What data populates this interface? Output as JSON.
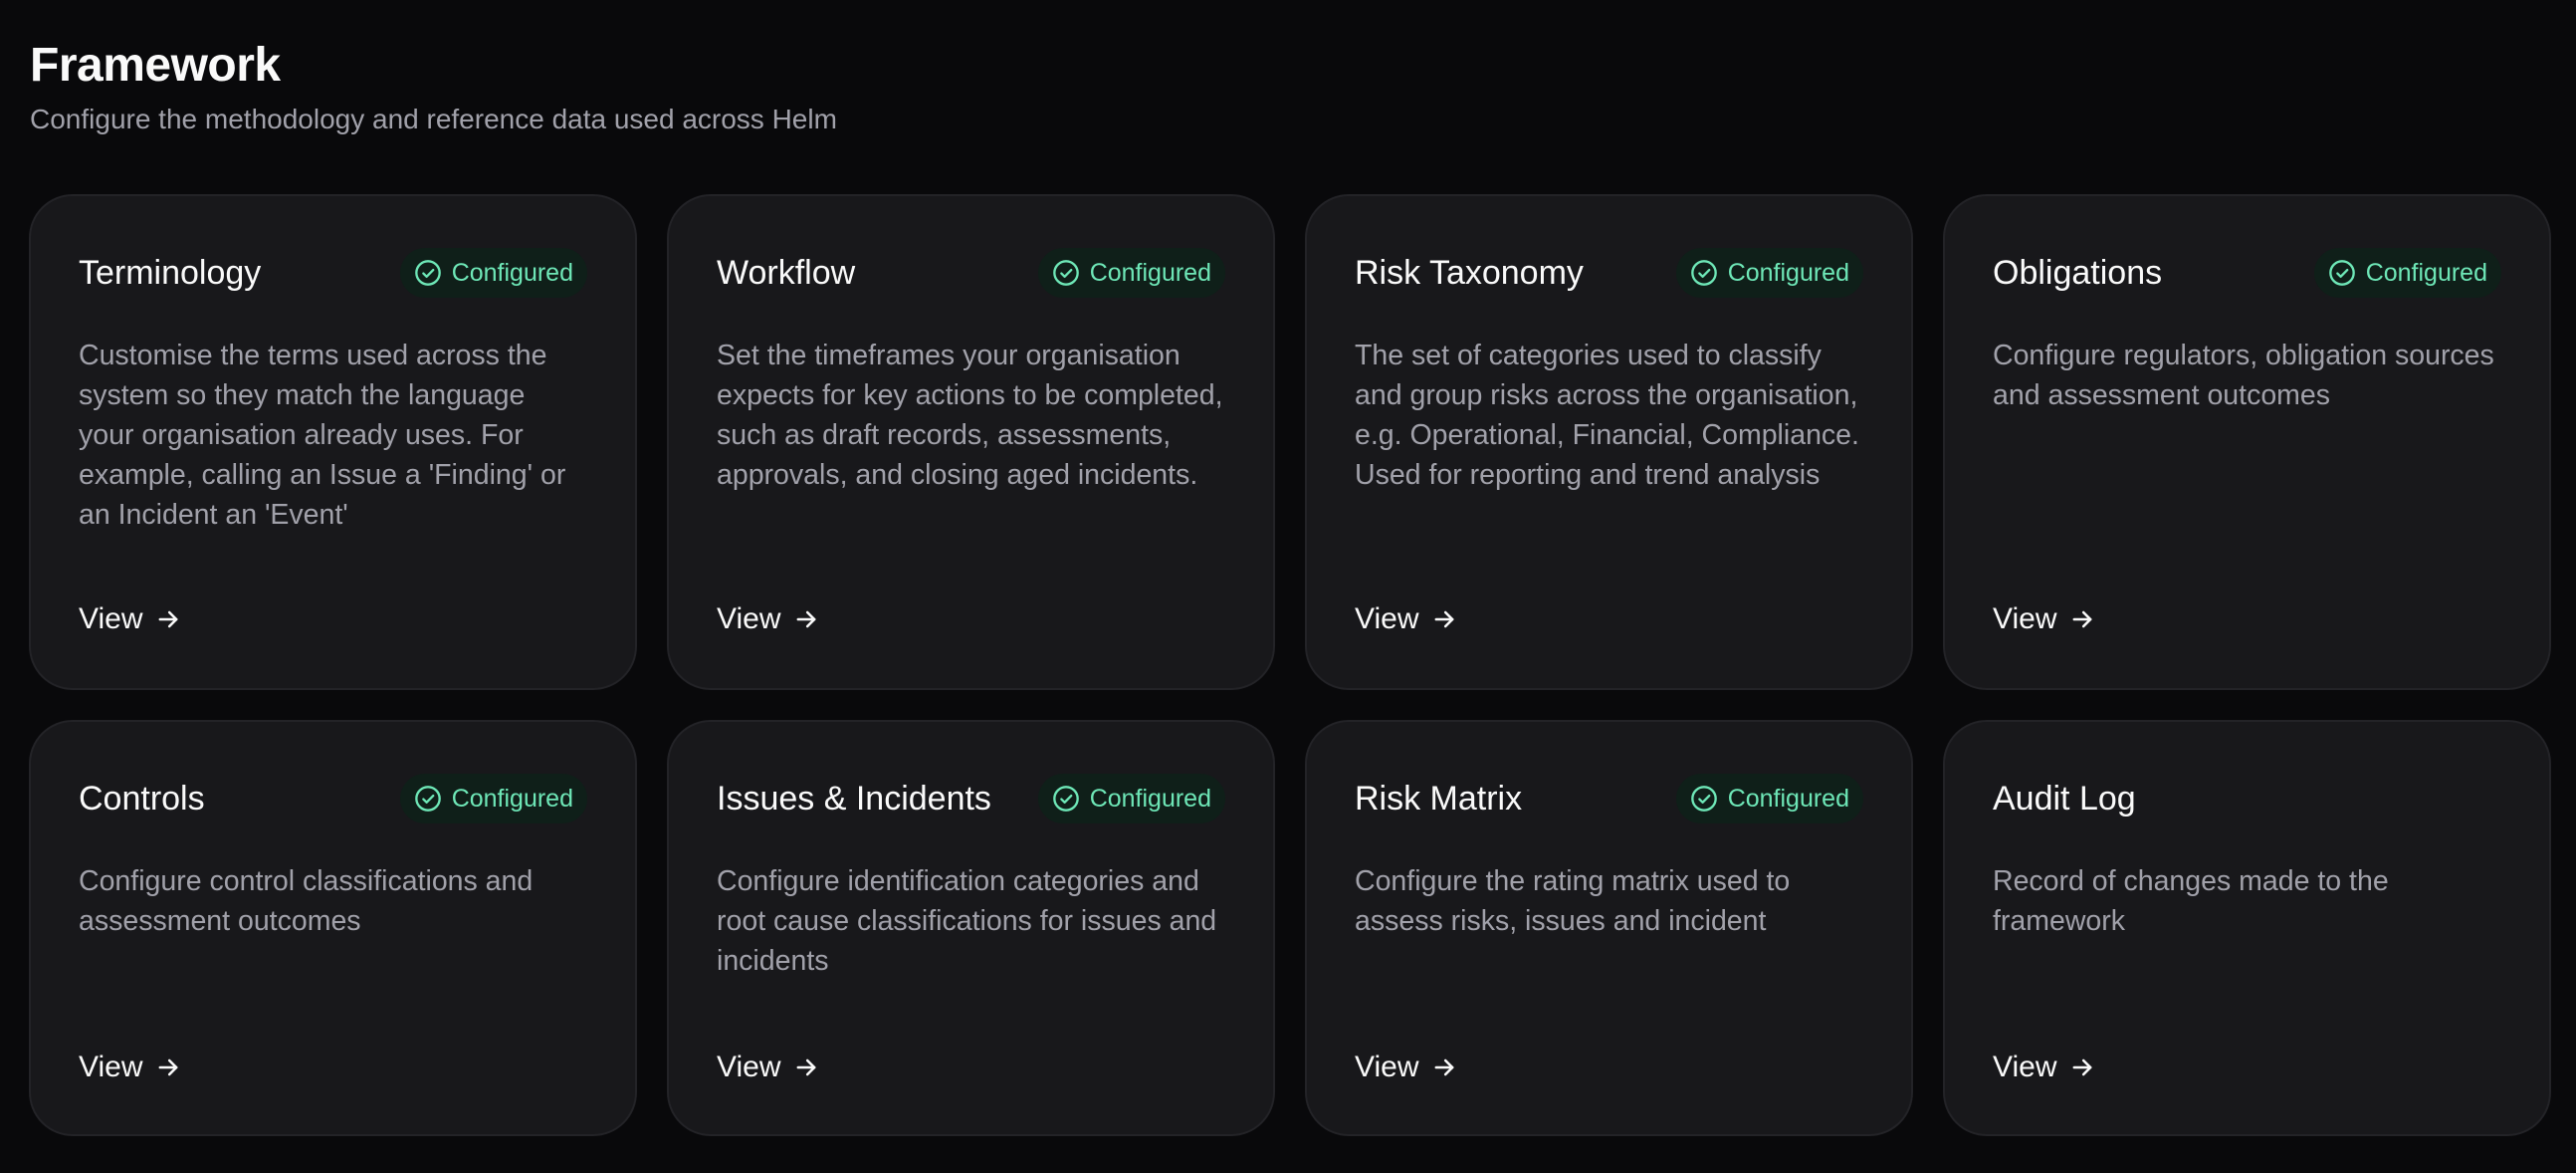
{
  "header": {
    "title": "Framework",
    "subtitle": "Configure the methodology and reference data used across Helm"
  },
  "colors": {
    "background": "#09090b",
    "card": "#18181b",
    "status_green": "#6ee7b7",
    "muted_text": "#a1a1aa"
  },
  "cards": [
    {
      "title": "Terminology",
      "status": "Configured",
      "description": "Customise the terms used across the system so they match the language your organisation already uses. For example, calling an Issue a 'Finding' or an Incident an 'Event'",
      "link": "View",
      "icon": "check-circle-icon"
    },
    {
      "title": "Workflow",
      "status": "Configured",
      "description": "Set the timeframes your organisation expects for key actions to be completed, such as draft records, assessments, approvals, and closing aged incidents.",
      "link": "View",
      "icon": "check-circle-icon"
    },
    {
      "title": "Risk Taxonomy",
      "status": "Configured",
      "description": "The set of categories used to classify and group risks across the organisation, e.g. Operational, Financial, Compliance. Used for reporting and trend analysis",
      "link": "View",
      "icon": "check-circle-icon"
    },
    {
      "title": "Obligations",
      "status": "Configured",
      "description": "Configure regulators, obligation sources and assessment outcomes",
      "link": "View",
      "icon": "check-circle-icon"
    },
    {
      "title": "Controls",
      "status": "Configured",
      "description": "Configure control classifications and assessment outcomes",
      "link": "View",
      "icon": "check-circle-icon"
    },
    {
      "title": "Issues & Incidents",
      "status": "Configured",
      "description": "Configure identification categories and root cause classifications for issues and incidents",
      "link": "View",
      "icon": "check-circle-icon"
    },
    {
      "title": "Risk Matrix",
      "status": "Configured",
      "description": "Configure the rating matrix used to assess risks, issues and incident",
      "link": "View",
      "icon": "check-circle-icon"
    },
    {
      "title": "Audit Log",
      "status": "",
      "description": "Record of changes made to the framework",
      "link": "View",
      "icon": ""
    }
  ]
}
